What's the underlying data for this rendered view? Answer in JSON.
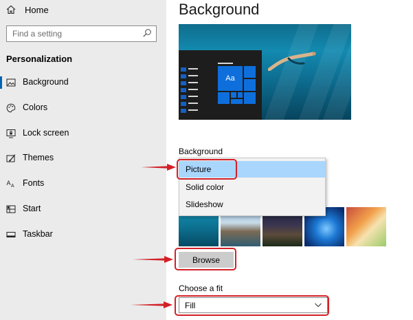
{
  "sidebar": {
    "home_label": "Home",
    "search_placeholder": "Find a setting",
    "section_title": "Personalization",
    "items": [
      {
        "label": "Background",
        "icon": "picture-icon"
      },
      {
        "label": "Colors",
        "icon": "palette-icon"
      },
      {
        "label": "Lock screen",
        "icon": "lock-screen-icon"
      },
      {
        "label": "Themes",
        "icon": "themes-icon"
      },
      {
        "label": "Fonts",
        "icon": "fonts-icon"
      },
      {
        "label": "Start",
        "icon": "start-icon"
      },
      {
        "label": "Taskbar",
        "icon": "taskbar-icon"
      }
    ],
    "active_item": "Background"
  },
  "main": {
    "title": "Background",
    "preview_tile_text": "Aa",
    "background_label": "Background",
    "background_options": [
      "Picture",
      "Solid color",
      "Slideshow"
    ],
    "background_selected": "Picture",
    "browse_label": "Browse",
    "fit_label": "Choose a fit",
    "fit_value": "Fill"
  },
  "colors": {
    "accent": "#0063b1",
    "tile_blue": "#0e6fdc",
    "selected_option": "#a9d6fd",
    "annotation_red": "#d22128"
  }
}
